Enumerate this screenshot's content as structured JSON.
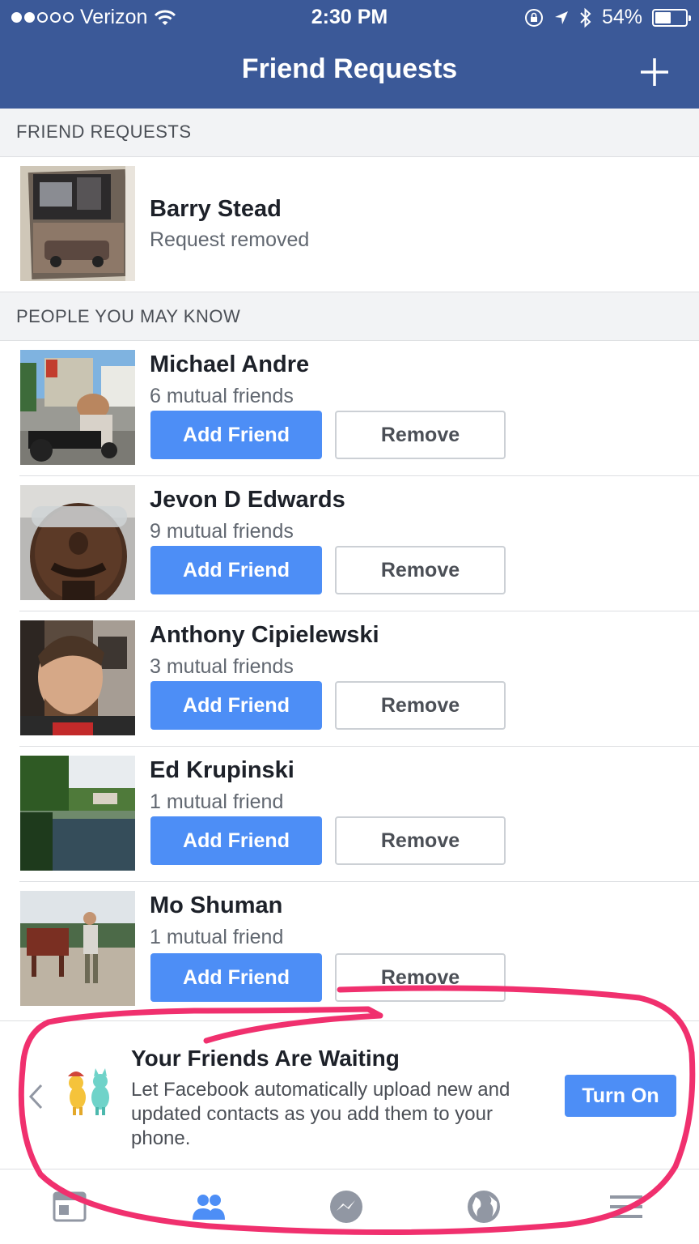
{
  "status_bar": {
    "carrier": "Verizon",
    "time": "2:30 PM",
    "battery": "54%",
    "battery_level": 0.54
  },
  "nav": {
    "title": "Friend Requests"
  },
  "sections": {
    "friend_requests": "FRIEND REQUESTS",
    "people_you_may_know": "PEOPLE YOU MAY KNOW"
  },
  "requests": [
    {
      "name": "Barry Stead",
      "status": "Request removed"
    }
  ],
  "suggestions": [
    {
      "name": "Michael Andre",
      "mutual": "6 mutual friends",
      "add_label": "Add Friend",
      "remove_label": "Remove"
    },
    {
      "name": "Jevon D Edwards",
      "mutual": "9 mutual friends",
      "add_label": "Add Friend",
      "remove_label": "Remove"
    },
    {
      "name": "Anthony Cipielewski",
      "mutual": "3 mutual friends",
      "add_label": "Add Friend",
      "remove_label": "Remove"
    },
    {
      "name": "Ed Krupinski",
      "mutual": "1 mutual friend",
      "add_label": "Add Friend",
      "remove_label": "Remove"
    },
    {
      "name": "Mo Shuman",
      "mutual": "1 mutual friend",
      "add_label": "Add Friend",
      "remove_label": "Remove"
    }
  ],
  "banner": {
    "title": "Your Friends Are Waiting",
    "text": "Let Facebook automatically upload new and updated contacts as you add them to your phone.",
    "button": "Turn On"
  },
  "tabs": [
    {
      "icon": "news-feed-icon"
    },
    {
      "icon": "friends-icon",
      "active": true
    },
    {
      "icon": "messenger-icon"
    },
    {
      "icon": "globe-icon"
    },
    {
      "icon": "menu-icon"
    }
  ],
  "colors": {
    "brand": "#3b5998",
    "button_blue": "#4d8ef6",
    "annotation": "#f0306e"
  }
}
